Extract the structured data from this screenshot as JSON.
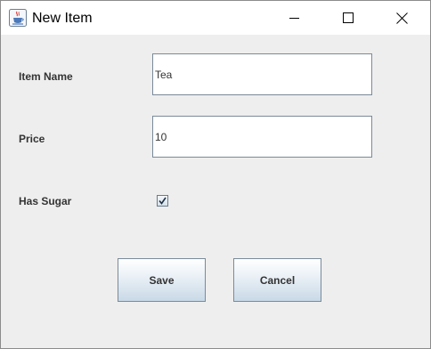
{
  "window": {
    "title": "New Item",
    "icon": "java-cup-icon",
    "controls": [
      "minimize-icon",
      "maximize-icon",
      "close-icon"
    ]
  },
  "form": {
    "item_name_label": "Item Name",
    "item_name_value": "Tea",
    "price_label": "Price",
    "price_value": "10",
    "has_sugar_label": "Has Sugar",
    "has_sugar_checked": true
  },
  "buttons": {
    "save_label": "Save",
    "cancel_label": "Cancel"
  },
  "colors": {
    "window_background": "#eeeeee",
    "titlebar_background": "#ffffff",
    "field_border": "#7a8a99",
    "button_gradient_bottom": "#c9d9e7"
  }
}
